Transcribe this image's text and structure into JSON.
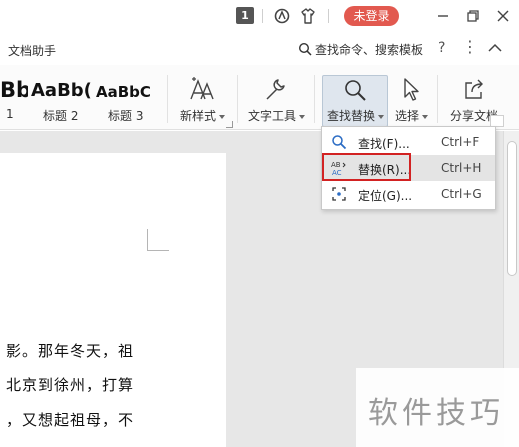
{
  "titlebar": {
    "badge": "1",
    "login_label": "未登录",
    "colors": {
      "login_bg": "#e2594f"
    }
  },
  "menubar": {
    "doc_assistant": "文档助手",
    "search_label": "查找命令、搜索模板",
    "help": "?",
    "more": "⋮"
  },
  "ribbon": {
    "styles": [
      {
        "sample": "Bb",
        "label": "1"
      },
      {
        "sample": "AaBb(",
        "label": "标题 2"
      },
      {
        "sample": "AaBbC",
        "label": "标题 3"
      }
    ],
    "new_style": "新样式",
    "text_tools": "文字工具",
    "find_replace": "查找替换",
    "select": "选择",
    "share_doc": "分享文档"
  },
  "dropdown": {
    "items": [
      {
        "label": "查找(F)...",
        "shortcut": "Ctrl+F",
        "icon": "magnifier-icon"
      },
      {
        "label": "替换(R)...",
        "shortcut": "Ctrl+H",
        "icon": "replace-icon"
      },
      {
        "label": "定位(G)...",
        "shortcut": "Ctrl+G",
        "icon": "goto-icon"
      }
    ],
    "highlighted_index": 1
  },
  "document": {
    "lines": [
      "影。那年冬天，祖",
      "北京到徐州，打算",
      "，又想起祖母，不"
    ]
  },
  "watermark": "软件技巧"
}
